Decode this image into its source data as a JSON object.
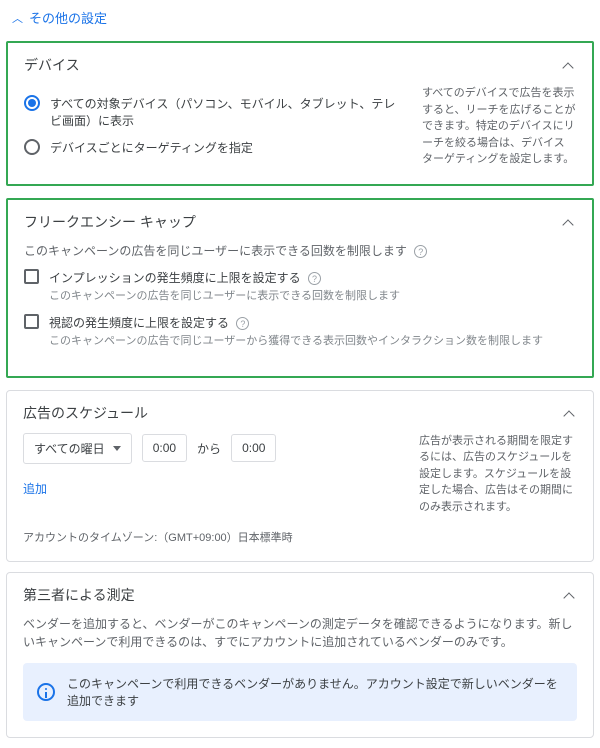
{
  "header": {
    "collapse_label": "その他の設定"
  },
  "devices": {
    "title": "デバイス",
    "options": [
      {
        "label": "すべての対象デバイス（パソコン、モバイル、タブレット、テレビ画面）に表示",
        "selected": true
      },
      {
        "label": "デバイスごとにターゲティングを指定",
        "selected": false
      }
    ],
    "help": "すべてのデバイスで広告を表示すると、リーチを広げることができます。特定のデバイスにリーチを絞る場合は、デバイス ターゲティングを設定します。"
  },
  "frequency_cap": {
    "title": "フリークエンシー キャップ",
    "description": "このキャンペーンの広告を同じユーザーに表示できる回数を制限します",
    "options": [
      {
        "label": "インプレッションの発生頻度に上限を設定する",
        "sub": "このキャンペーンの広告を同じユーザーに表示できる回数を制限します"
      },
      {
        "label": "視認の発生頻度に上限を設定する",
        "sub": "このキャンペーンの広告で同じユーザーから獲得できる表示回数やインタラクション数を制限します"
      }
    ]
  },
  "schedule": {
    "title": "広告のスケジュール",
    "day_select": "すべての曜日",
    "time_from": "0:00",
    "from_label": "から",
    "time_to": "0:00",
    "add_label": "追加",
    "tz_note": "アカウントのタイムゾーン:（GMT+09:00）日本標準時",
    "help": "広告が表示される期間を限定するには、広告のスケジュールを設定します。スケジュールを設定した場合、広告はその期間にのみ表示されます。"
  },
  "third_party": {
    "title": "第三者による測定",
    "description": "ベンダーを追加すると、ベンダーがこのキャンペーンの測定データを確認できるようになります。新しいキャンペーンで利用できるのは、すでにアカウントに追加されているベンダーのみです。",
    "info": "このキャンペーンで利用できるベンダーがありません。アカウント設定で新しいベンダーを追加できます"
  }
}
